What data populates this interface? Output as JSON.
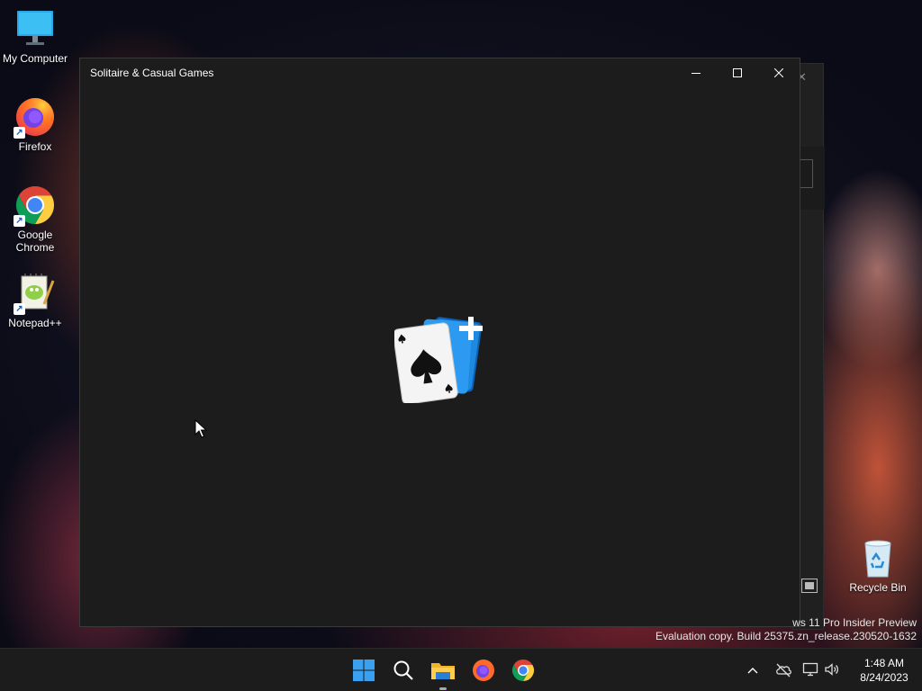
{
  "desktop": {
    "icons": [
      {
        "label": "My Computer",
        "icon": "monitor-icon"
      },
      {
        "label": "Firefox",
        "icon": "firefox-icon"
      },
      {
        "label": "Google Chrome",
        "icon": "chrome-icon"
      },
      {
        "label": "Notepad++",
        "icon": "notepadpp-icon"
      },
      {
        "label": "Recycle Bin",
        "icon": "recycle-bin-icon"
      }
    ]
  },
  "window": {
    "title": "Solitaire & Casual Games",
    "logo_icon": "solitaire-cards-icon"
  },
  "watermark": {
    "line1": "ws 11 Pro Insider Preview",
    "line2": "Evaluation copy. Build 25375.zn_release.230520-1632"
  },
  "taskbar": {
    "apps": [
      "start-icon",
      "search-icon",
      "file-explorer-icon",
      "firefox-icon",
      "chrome-icon"
    ],
    "tray": [
      "chevron-up-icon",
      "cloud-offline-icon",
      "network-icon",
      "volume-icon"
    ],
    "time": "1:48 AM",
    "date": "8/24/2023"
  },
  "colors": {
    "window_bg": "#1c1c1c",
    "taskbar_bg": "#1c1c1c",
    "accent": "#0078d4"
  }
}
